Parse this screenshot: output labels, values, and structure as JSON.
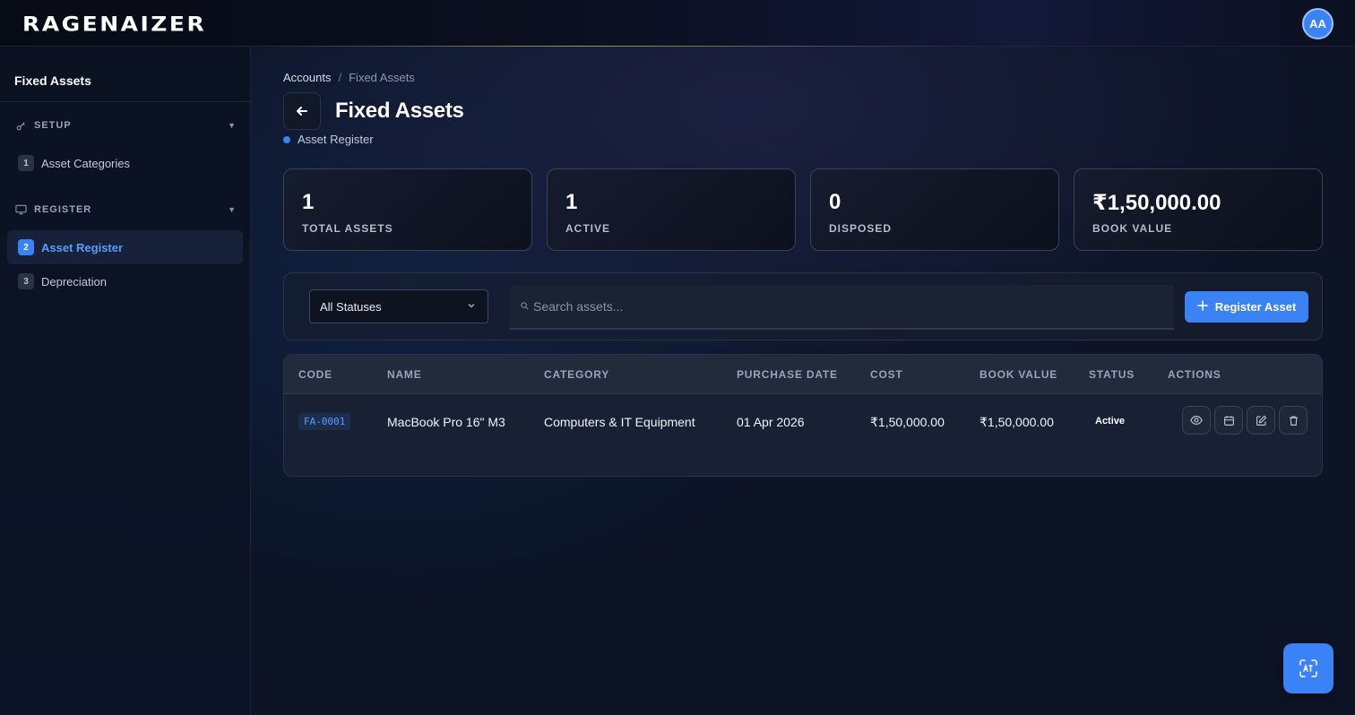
{
  "app": {
    "logo": "RAGENAIZER",
    "avatar_initials": "AA"
  },
  "sidebar": {
    "title": "Fixed Assets",
    "sections": [
      {
        "label": "SETUP",
        "icon": "key-icon",
        "items": [
          {
            "num": "1",
            "label": "Asset Categories"
          }
        ]
      },
      {
        "label": "REGISTER",
        "icon": "monitor-icon",
        "items": [
          {
            "num": "2",
            "label": "Asset Register",
            "active": true
          },
          {
            "num": "3",
            "label": "Depreciation"
          }
        ]
      }
    ]
  },
  "breadcrumb": {
    "root": "Accounts",
    "separator": "/",
    "current": "Fixed Assets"
  },
  "page": {
    "title": "Fixed Assets",
    "subtitle": "Asset Register"
  },
  "stats": [
    {
      "value": "1",
      "label": "TOTAL ASSETS"
    },
    {
      "value": "1",
      "label": "ACTIVE"
    },
    {
      "value": "0",
      "label": "DISPOSED"
    },
    {
      "value": "₹1,50,000.00",
      "label": "BOOK VALUE"
    }
  ],
  "filters": {
    "status_selected": "All Statuses",
    "search_placeholder": "Search assets...",
    "register_label": "Register Asset"
  },
  "table": {
    "columns": [
      "CODE",
      "NAME",
      "CATEGORY",
      "PURCHASE DATE",
      "COST",
      "BOOK VALUE",
      "STATUS",
      "ACTIONS"
    ],
    "rows": [
      {
        "code": "FA-0001",
        "name": "MacBook Pro 16\" M3",
        "category": "Computers & IT Equipment",
        "purchase_date": "01 Apr 2026",
        "cost": "₹1,50,000.00",
        "book_value": "₹1,50,000.00",
        "status": "Active",
        "actions": [
          "eye-icon",
          "calendar-icon",
          "edit-icon",
          "trash-icon"
        ]
      }
    ]
  },
  "colors": {
    "accent": "#3b82f6",
    "background": "#0c1426",
    "sidebar": "#0b1222"
  }
}
